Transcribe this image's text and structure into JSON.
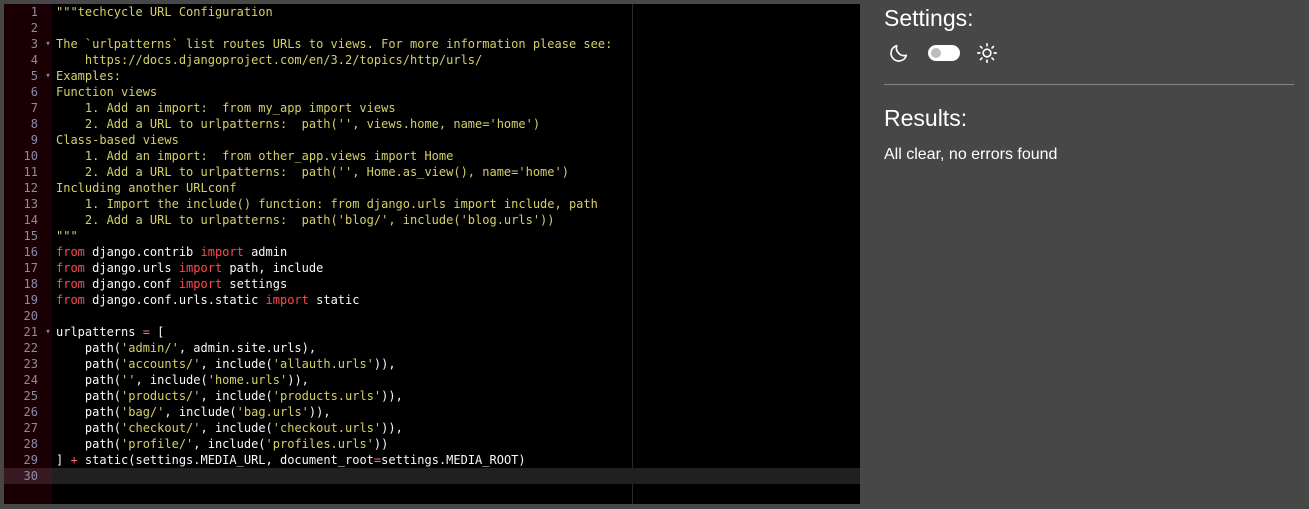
{
  "editor": {
    "active_line": 30,
    "lines": [
      {
        "n": "1",
        "fold": "",
        "tokens": [
          {
            "t": "\"\"\"techcycle URL Configuration",
            "c": "comment"
          }
        ]
      },
      {
        "n": "2",
        "fold": "",
        "tokens": []
      },
      {
        "n": "3",
        "fold": "▾",
        "tokens": [
          {
            "t": "The `urlpatterns` list routes URLs to views. For more information please see:",
            "c": "comment"
          }
        ]
      },
      {
        "n": "4",
        "fold": "",
        "tokens": [
          {
            "t": "    https://docs.djangoproject.com/en/3.2/topics/http/urls/",
            "c": "comment"
          }
        ]
      },
      {
        "n": "5",
        "fold": "▾",
        "tokens": [
          {
            "t": "Examples:",
            "c": "comment"
          }
        ]
      },
      {
        "n": "6",
        "fold": "",
        "tokens": [
          {
            "t": "Function views",
            "c": "comment"
          }
        ]
      },
      {
        "n": "7",
        "fold": "",
        "tokens": [
          {
            "t": "    1. Add an import:  from my_app import views",
            "c": "comment"
          }
        ]
      },
      {
        "n": "8",
        "fold": "",
        "tokens": [
          {
            "t": "    2. Add a URL to urlpatterns:  path('', views.home, name='home')",
            "c": "comment"
          }
        ]
      },
      {
        "n": "9",
        "fold": "",
        "tokens": [
          {
            "t": "Class-based views",
            "c": "comment"
          }
        ]
      },
      {
        "n": "10",
        "fold": "",
        "tokens": [
          {
            "t": "    1. Add an import:  from other_app.views import Home",
            "c": "comment"
          }
        ]
      },
      {
        "n": "11",
        "fold": "",
        "tokens": [
          {
            "t": "    2. Add a URL to urlpatterns:  path('', Home.as_view(), name='home')",
            "c": "comment"
          }
        ]
      },
      {
        "n": "12",
        "fold": "",
        "tokens": [
          {
            "t": "Including another URLconf",
            "c": "comment"
          }
        ]
      },
      {
        "n": "13",
        "fold": "",
        "tokens": [
          {
            "t": "    1. Import the include() function: from django.urls import include, path",
            "c": "comment"
          }
        ]
      },
      {
        "n": "14",
        "fold": "",
        "tokens": [
          {
            "t": "    2. Add a URL to urlpatterns:  path('blog/', include('blog.urls'))",
            "c": "comment"
          }
        ]
      },
      {
        "n": "15",
        "fold": "",
        "tokens": [
          {
            "t": "\"\"\"",
            "c": "comment"
          }
        ]
      },
      {
        "n": "16",
        "fold": "",
        "tokens": [
          {
            "t": "from",
            "c": "keyword"
          },
          {
            "t": " django.contrib ",
            "c": "ident"
          },
          {
            "t": "import",
            "c": "keyword"
          },
          {
            "t": " admin",
            "c": "ident"
          }
        ]
      },
      {
        "n": "17",
        "fold": "",
        "tokens": [
          {
            "t": "from",
            "c": "keyword"
          },
          {
            "t": " django.urls ",
            "c": "ident"
          },
          {
            "t": "import",
            "c": "keyword"
          },
          {
            "t": " path, include",
            "c": "ident"
          }
        ]
      },
      {
        "n": "18",
        "fold": "",
        "tokens": [
          {
            "t": "from",
            "c": "keyword"
          },
          {
            "t": " django.conf ",
            "c": "ident"
          },
          {
            "t": "import",
            "c": "keyword"
          },
          {
            "t": " settings",
            "c": "ident"
          }
        ]
      },
      {
        "n": "19",
        "fold": "",
        "tokens": [
          {
            "t": "from",
            "c": "keyword"
          },
          {
            "t": " django.conf.urls.static ",
            "c": "ident"
          },
          {
            "t": "import",
            "c": "keyword"
          },
          {
            "t": " static",
            "c": "ident"
          }
        ]
      },
      {
        "n": "20",
        "fold": "",
        "tokens": []
      },
      {
        "n": "21",
        "fold": "▾",
        "tokens": [
          {
            "t": "urlpatterns ",
            "c": "ident"
          },
          {
            "t": "=",
            "c": "operator"
          },
          {
            "t": " [",
            "c": "ident"
          }
        ]
      },
      {
        "n": "22",
        "fold": "",
        "tokens": [
          {
            "t": "    path(",
            "c": "ident"
          },
          {
            "t": "'admin/'",
            "c": "string"
          },
          {
            "t": ", admin.site.urls),",
            "c": "ident"
          }
        ]
      },
      {
        "n": "23",
        "fold": "",
        "tokens": [
          {
            "t": "    path(",
            "c": "ident"
          },
          {
            "t": "'accounts/'",
            "c": "string"
          },
          {
            "t": ", include(",
            "c": "ident"
          },
          {
            "t": "'allauth.urls'",
            "c": "string"
          },
          {
            "t": ")),",
            "c": "ident"
          }
        ]
      },
      {
        "n": "24",
        "fold": "",
        "tokens": [
          {
            "t": "    path(",
            "c": "ident"
          },
          {
            "t": "''",
            "c": "string"
          },
          {
            "t": ", include(",
            "c": "ident"
          },
          {
            "t": "'home.urls'",
            "c": "string"
          },
          {
            "t": ")),",
            "c": "ident"
          }
        ]
      },
      {
        "n": "25",
        "fold": "",
        "tokens": [
          {
            "t": "    path(",
            "c": "ident"
          },
          {
            "t": "'products/'",
            "c": "string"
          },
          {
            "t": ", include(",
            "c": "ident"
          },
          {
            "t": "'products.urls'",
            "c": "string"
          },
          {
            "t": ")),",
            "c": "ident"
          }
        ]
      },
      {
        "n": "26",
        "fold": "",
        "tokens": [
          {
            "t": "    path(",
            "c": "ident"
          },
          {
            "t": "'bag/'",
            "c": "string"
          },
          {
            "t": ", include(",
            "c": "ident"
          },
          {
            "t": "'bag.urls'",
            "c": "string"
          },
          {
            "t": ")),",
            "c": "ident"
          }
        ]
      },
      {
        "n": "27",
        "fold": "",
        "tokens": [
          {
            "t": "    path(",
            "c": "ident"
          },
          {
            "t": "'checkout/'",
            "c": "string"
          },
          {
            "t": ", include(",
            "c": "ident"
          },
          {
            "t": "'checkout.urls'",
            "c": "string"
          },
          {
            "t": ")),",
            "c": "ident"
          }
        ]
      },
      {
        "n": "28",
        "fold": "",
        "tokens": [
          {
            "t": "    path(",
            "c": "ident"
          },
          {
            "t": "'profile/'",
            "c": "string"
          },
          {
            "t": ", include(",
            "c": "ident"
          },
          {
            "t": "'profiles.urls'",
            "c": "string"
          },
          {
            "t": "))",
            "c": "ident"
          }
        ]
      },
      {
        "n": "29",
        "fold": "",
        "tokens": [
          {
            "t": "] ",
            "c": "ident"
          },
          {
            "t": "+",
            "c": "operator"
          },
          {
            "t": " static(settings.MEDIA_URL, document_root",
            "c": "ident"
          },
          {
            "t": "=",
            "c": "operator"
          },
          {
            "t": "settings.MEDIA_ROOT)",
            "c": "ident"
          }
        ]
      },
      {
        "n": "30",
        "fold": "",
        "tokens": []
      }
    ]
  },
  "settings": {
    "title": "Settings:",
    "dark_icon": "moon-icon",
    "light_icon": "sun-icon",
    "theme_toggle_state": "off"
  },
  "results": {
    "title": "Results:",
    "message": "All clear, no errors found"
  },
  "colors": {
    "page_background": "#474747",
    "editor_background": "#000000",
    "gutter_background": "#1a0005",
    "comment": "#d4d068",
    "keyword": "#ff4a4a",
    "string": "#d4d068",
    "text": "#f8f8f8",
    "line_number": "#8d8da2"
  }
}
